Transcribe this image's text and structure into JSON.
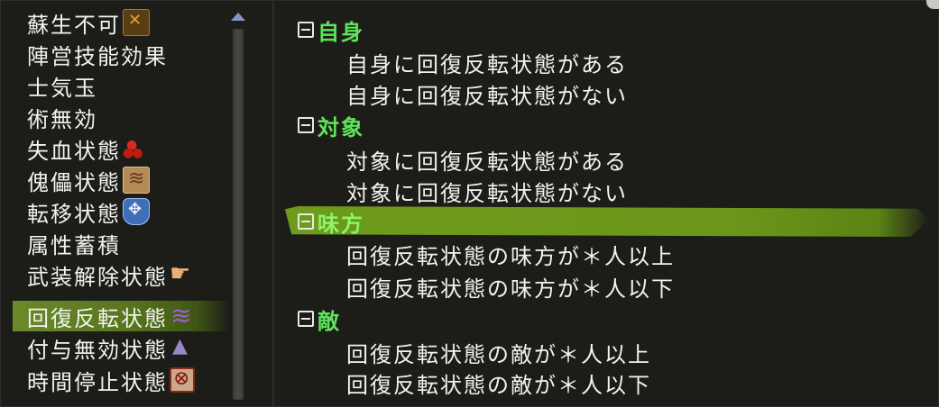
{
  "left_list": {
    "items": [
      {
        "label": "蘇生不可",
        "icon": "revive-disabled-icon"
      },
      {
        "label": "陣営技能効果",
        "icon": ""
      },
      {
        "label": "士気玉",
        "icon": ""
      },
      {
        "label": "術無効",
        "icon": ""
      },
      {
        "label": "失血状態",
        "icon": "bleeding-icon"
      },
      {
        "label": "傀儡状態",
        "icon": "puppet-icon"
      },
      {
        "label": "転移状態",
        "icon": "transfer-icon"
      },
      {
        "label": "属性蓄積",
        "icon": ""
      },
      {
        "label": "武装解除状態",
        "icon": "disarm-icon"
      },
      {
        "label": "回復反転状態",
        "icon": "heal-reverse-icon"
      },
      {
        "label": "付与無効状態",
        "icon": "buff-nullify-icon"
      },
      {
        "label": "時間停止状態",
        "icon": "time-stop-icon"
      }
    ],
    "selected_index": 9
  },
  "tree": {
    "groups": [
      {
        "label": "自身",
        "children": [
          "自身に回復反転状態がある",
          "自身に回復反転状態がない"
        ]
      },
      {
        "label": "対象",
        "children": [
          "対象に回復反転状態がある",
          "対象に回復反転状態がない"
        ]
      },
      {
        "label": "味方",
        "children": [
          "回復反転状態の味方が＊人以上",
          "回復反転状態の味方が＊人以下"
        ]
      },
      {
        "label": "敵",
        "children": [
          "回復反転状態の敵が＊人以上",
          "回復反転状態の敵が＊人以下"
        ]
      }
    ],
    "highlighted_group_index": 2
  },
  "colors": {
    "background": "#1c1d19",
    "group_text": "#5fe35a",
    "selection_green": "#6b961a",
    "text": "#f2f2ee"
  }
}
